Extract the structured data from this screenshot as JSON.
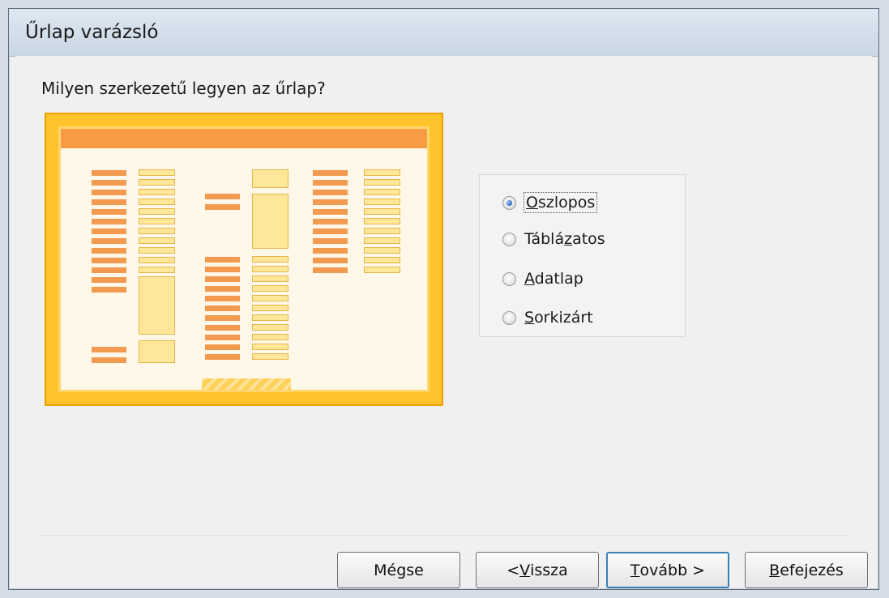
{
  "window": {
    "title": "Űrlap varázsló"
  },
  "prompt": "Milyen szerkezetű legyen az űrlap?",
  "layout_options": [
    {
      "label": "Oszlopos",
      "selected": true,
      "mnemonic": "O"
    },
    {
      "label": "Táblázatos",
      "selected": false,
      "mnemonic": "z"
    },
    {
      "label": "Adatlap",
      "selected": false,
      "mnemonic": "A"
    },
    {
      "label": "Sorkizárt",
      "selected": false,
      "mnemonic": "S"
    }
  ],
  "buttons": {
    "cancel": "Mégse",
    "back": "< Vissza",
    "next": "Tovább >",
    "finish": "Befejezés"
  },
  "colors": {
    "preview_border": "#ffc42b",
    "preview_header": "#f79c45",
    "field_fill": "#ffe79a",
    "label_fill": "#f29a4f"
  }
}
